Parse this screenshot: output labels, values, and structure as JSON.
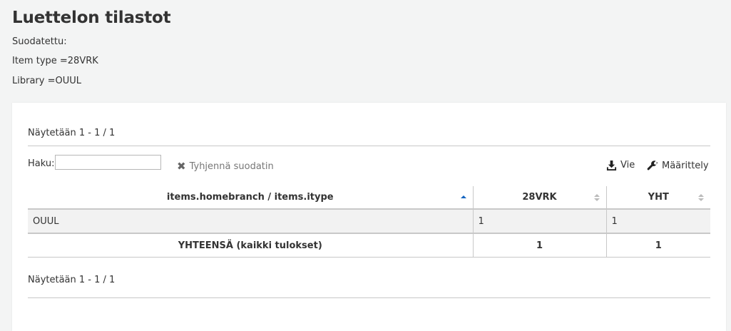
{
  "page": {
    "title": "Luettelon tilastot",
    "filtered_label": "Suodatettu:",
    "filters": [
      "Item type =28VRK",
      "Library =OUUL"
    ]
  },
  "table_info": {
    "top": "Näytetään 1 - 1 / 1",
    "bottom": "Näytetään 1 - 1 / 1"
  },
  "toolbar": {
    "search_label": "Haku:",
    "search_value": "",
    "clear_filter": "Tyhjennä suodatin",
    "export": "Vie",
    "configure": "Määrittely"
  },
  "table": {
    "headers": [
      "items.homebranch / items.itype",
      "28VRK",
      "YHT"
    ],
    "sorted_column": 0,
    "sort_color": "#1565c0",
    "rows": [
      [
        "OUUL",
        "1",
        "1"
      ]
    ],
    "total_row": [
      "YHTEENSÄ (kaikki tulokset)",
      "1",
      "1"
    ]
  }
}
